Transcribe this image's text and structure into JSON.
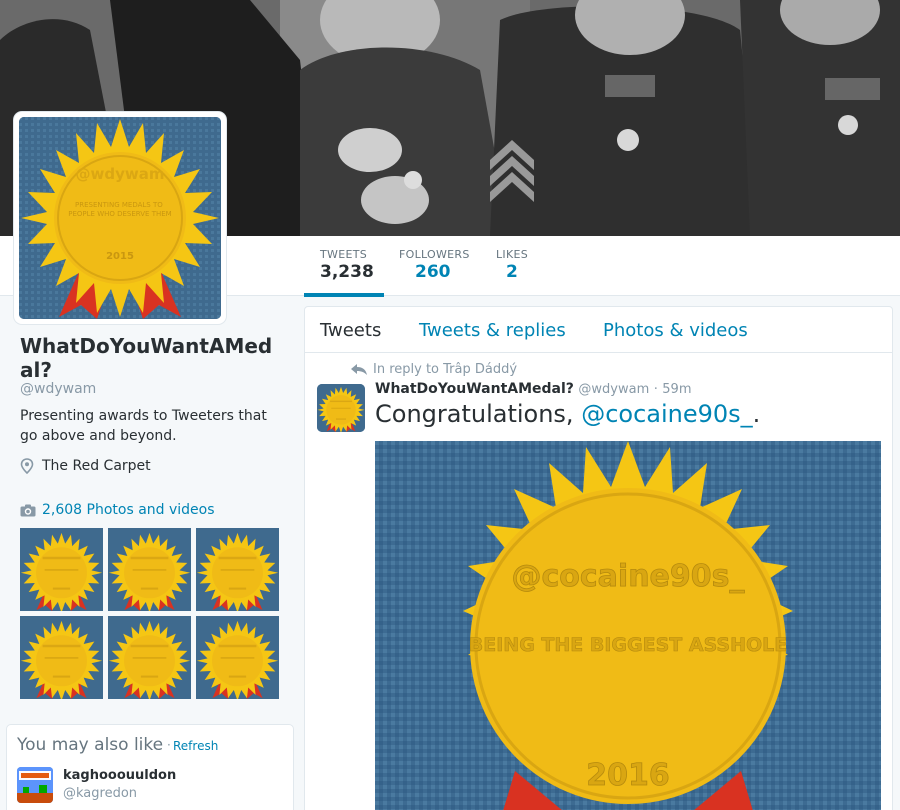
{
  "nav": {
    "stats": [
      {
        "label": "TWEETS",
        "value": "3,238"
      },
      {
        "label": "FOLLOWERS",
        "value": "260"
      },
      {
        "label": "LIKES",
        "value": "2"
      }
    ]
  },
  "profile": {
    "name": "WhatDoYouWantAMedal?",
    "name_line1": "WhatDoYouWantAMed",
    "name_line2": "al?",
    "handle": "@wdywam",
    "bio": "Presenting awards to Tweeters that go above and beyond.",
    "location": "The Red Carpet",
    "photos_label": "2,608 Photos and videos",
    "avatar_medal": {
      "handle": "@wdywam",
      "caption": "PRESENTING MEDALS TO PEOPLE WHO DESERVE THEM",
      "year": "2015"
    }
  },
  "suggestions": {
    "title": "You may also like",
    "separator": "·",
    "refresh": "Refresh",
    "users": [
      {
        "name": "kaghooouuldon",
        "handle": "@kagredon"
      }
    ]
  },
  "timeline": {
    "tabs": [
      "Tweets",
      "Tweets & replies",
      "Photos & videos"
    ],
    "tweet": {
      "reply_context": "In reply to Trâp Dáddý",
      "name": "WhatDoYouWantAMedal?",
      "handle": "@wdywam",
      "dot": "·",
      "time": "59m",
      "text_prefix": "Congratulations, ",
      "mention": "@cocaine90s_",
      "text_suffix": ".",
      "medal": {
        "handle": "@cocaine90s_",
        "caption": "BEING THE BIGGEST ASSHOLE",
        "year": "2016"
      }
    }
  },
  "colors": {
    "accent": "#0084b4",
    "medal_gold": "#f2c11a",
    "ribbon": "#e0311f",
    "background_blue": "#3f6a8e"
  },
  "icons": [
    "reply-icon",
    "location-pin-icon",
    "camera-icon"
  ]
}
